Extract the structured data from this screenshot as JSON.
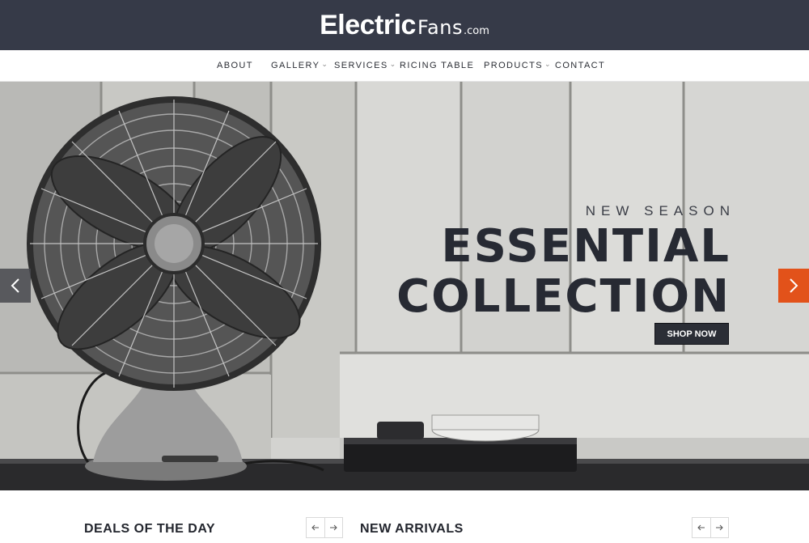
{
  "header": {
    "logo_strong": "Electric",
    "logo_light": "Fans",
    "logo_domain": ".com",
    "bg_color": "#363a48"
  },
  "nav": {
    "items": [
      {
        "label": "ABOUT",
        "has_dropdown": false
      },
      {
        "label": "GALLERY",
        "has_dropdown": true
      },
      {
        "label": "SERVICES",
        "has_dropdown": true
      },
      {
        "label": "RICING TABLE",
        "has_dropdown": false
      },
      {
        "label": "PRODUCTS",
        "has_dropdown": true
      },
      {
        "label": "CONTACT",
        "has_dropdown": false
      }
    ],
    "dropdown_icon": "chevron-down-icon"
  },
  "hero": {
    "kicker": "NEW SEASON",
    "headline_line1": "ESSENTIAL",
    "headline_line2": "COLLECTION",
    "cta_label": "SHOP NOW",
    "prev_icon": "chevron-left-icon",
    "next_icon": "chevron-right-icon",
    "accent_color": "#e2521a"
  },
  "sections": {
    "deals_title": "DEALS OF THE DAY",
    "arrivals_title": "NEW ARRIVALS",
    "pager_prev_icon": "arrow-left-icon",
    "pager_next_icon": "arrow-right-icon"
  }
}
